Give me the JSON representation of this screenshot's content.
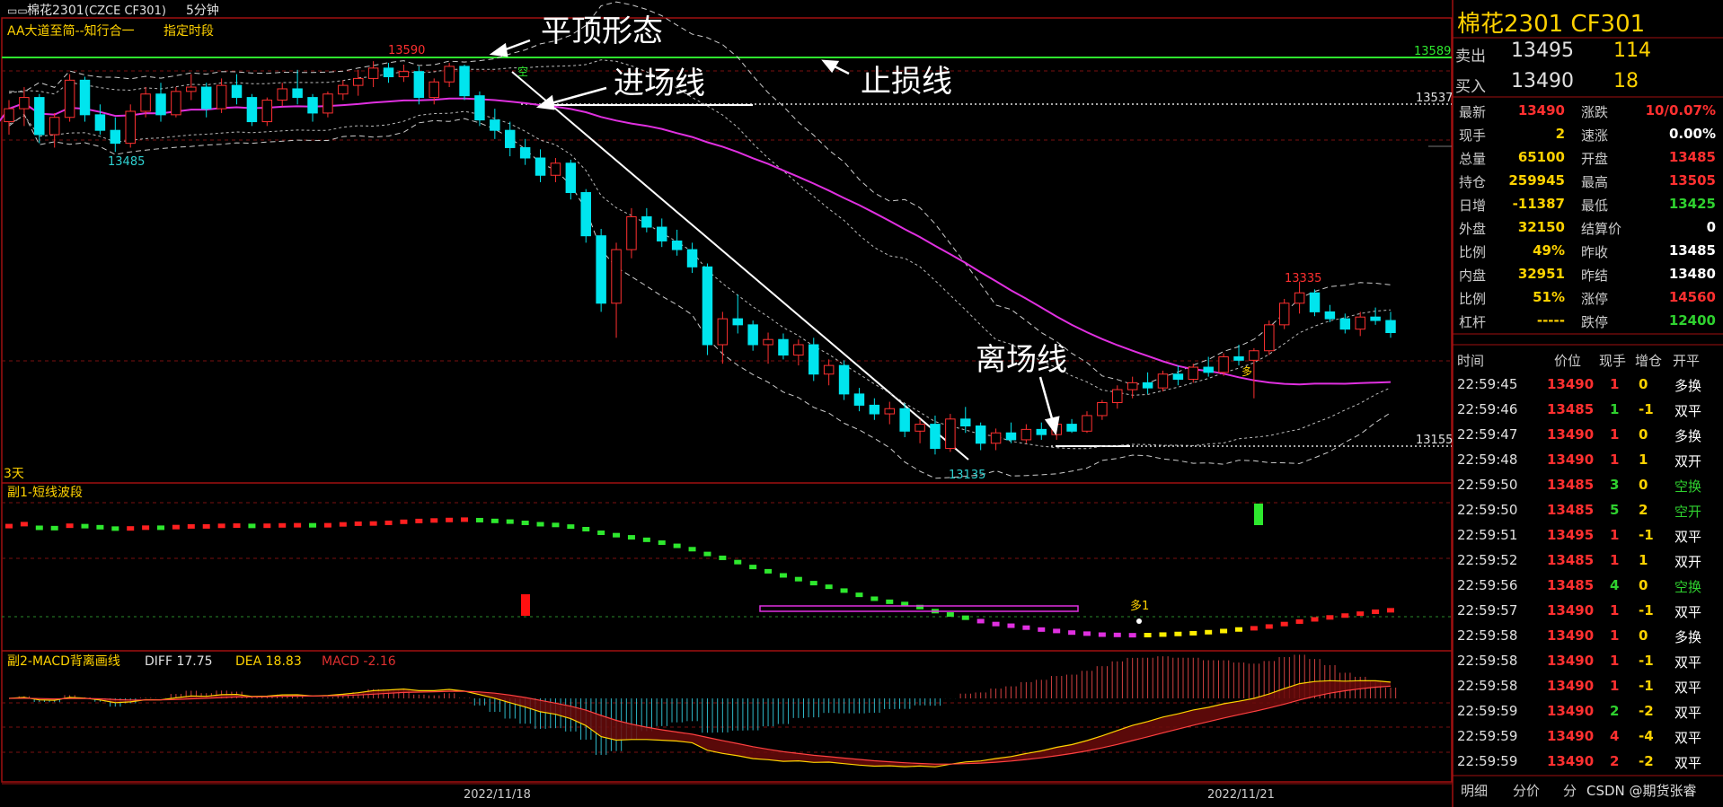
{
  "title": {
    "symbol": "棉花2301",
    "code": "(CZCE CF301)",
    "period": "5分钟"
  },
  "main_panel": {
    "indicator": "AA大道至简--知行合一",
    "segment": "指定时段",
    "span_label": "3天",
    "price_labels": {
      "high": "13590",
      "low": "13135",
      "left_low": "13485",
      "right_high": "13335"
    },
    "right_axis": {
      "stop": "13589",
      "entry": "13537",
      "exit": "13155"
    },
    "annotations": {
      "flat_top": "平顶形态",
      "entry": "进场线",
      "stop": "止损线",
      "exit": "离场线"
    },
    "markers": {
      "kong": "空",
      "duo": "多"
    }
  },
  "sub1": {
    "title": "副1-短线波段",
    "marker": "多1"
  },
  "sub2": {
    "title": "副2-MACD背离画线",
    "diff": "DIFF 17.75",
    "dea": "DEA 18.83",
    "macd": "MACD -2.16"
  },
  "x_axis": {
    "date1": "2022/11/18",
    "date2": "2022/11/21"
  },
  "quote": {
    "header": "棉花2301  CF301",
    "sell": {
      "label": "卖出",
      "price": "13495",
      "vol": "114"
    },
    "buy": {
      "label": "买入",
      "price": "13490",
      "vol": "18"
    },
    "stats": [
      [
        {
          "k": "最新",
          "v": "13490",
          "c": "#ff3030"
        },
        {
          "k": "涨跌",
          "v": "10/0.07%",
          "c": "#ff3030"
        }
      ],
      [
        {
          "k": "现手",
          "v": "2",
          "c": "#ffd200"
        },
        {
          "k": "速涨",
          "v": "0.00%",
          "c": "#ffffff"
        }
      ],
      [
        {
          "k": "总量",
          "v": "65100",
          "c": "#ffd200"
        },
        {
          "k": "开盘",
          "v": "13485",
          "c": "#ff3030"
        }
      ],
      [
        {
          "k": "持仓",
          "v": "259945",
          "c": "#ffd200"
        },
        {
          "k": "最高",
          "v": "13505",
          "c": "#ff3030"
        }
      ],
      [
        {
          "k": "日增",
          "v": "-11387",
          "c": "#ffd200"
        },
        {
          "k": "最低",
          "v": "13425",
          "c": "#2fd12f"
        }
      ],
      [
        {
          "k": "外盘",
          "v": "32150",
          "c": "#ffd200"
        },
        {
          "k": "结算价",
          "v": "0",
          "c": "#ffffff"
        }
      ],
      [
        {
          "k": "比例",
          "v": "49%",
          "c": "#ffd200"
        },
        {
          "k": "昨收",
          "v": "13485",
          "c": "#ffffff"
        }
      ],
      [
        {
          "k": "内盘",
          "v": "32951",
          "c": "#ffd200"
        },
        {
          "k": "昨结",
          "v": "13480",
          "c": "#ffffff"
        }
      ],
      [
        {
          "k": "比例",
          "v": "51%",
          "c": "#ffd200"
        },
        {
          "k": "涨停",
          "v": "14560",
          "c": "#ff3030"
        }
      ],
      [
        {
          "k": "杠杆",
          "v": "-----",
          "c": "#ffd200"
        },
        {
          "k": "跌停",
          "v": "12400",
          "c": "#2fd12f"
        }
      ]
    ],
    "trades_header": [
      "时间",
      "价位",
      "现手",
      "增仓",
      "开平"
    ],
    "trades": [
      [
        "22:59:45",
        "13490",
        "1",
        "0",
        "多换"
      ],
      [
        "22:59:46",
        "13485",
        "1",
        "-1",
        "双平"
      ],
      [
        "22:59:47",
        "13490",
        "1",
        "0",
        "多换"
      ],
      [
        "22:59:48",
        "13490",
        "1",
        "1",
        "双开"
      ],
      [
        "22:59:50",
        "13485",
        "3",
        "0",
        "空换"
      ],
      [
        "22:59:50",
        "13485",
        "5",
        "2",
        "空开"
      ],
      [
        "22:59:51",
        "13495",
        "1",
        "-1",
        "双平"
      ],
      [
        "22:59:52",
        "13485",
        "1",
        "1",
        "双开"
      ],
      [
        "22:59:56",
        "13485",
        "4",
        "0",
        "空换"
      ],
      [
        "22:59:57",
        "13490",
        "1",
        "-1",
        "双平"
      ],
      [
        "22:59:58",
        "13490",
        "1",
        "0",
        "多换"
      ],
      [
        "22:59:58",
        "13490",
        "1",
        "-1",
        "双平"
      ],
      [
        "22:59:58",
        "13490",
        "1",
        "-1",
        "双平"
      ],
      [
        "22:59:59",
        "13490",
        "2",
        "-2",
        "双平"
      ],
      [
        "22:59:59",
        "13490",
        "4",
        "-4",
        "双平"
      ],
      [
        "22:59:59",
        "13490",
        "2",
        "-2",
        "双平"
      ]
    ],
    "tabs": [
      "明细",
      "分价",
      "分"
    ],
    "watermark": "CSDN @期货张睿"
  },
  "chart_data": {
    "type": "candlestick",
    "ylim": [
      13100,
      13640
    ],
    "candles": [
      [
        13520,
        13545,
        13505,
        13535
      ],
      [
        13535,
        13560,
        13515,
        13548
      ],
      [
        13548,
        13552,
        13495,
        13505
      ],
      [
        13505,
        13530,
        13490,
        13525
      ],
      [
        13525,
        13575,
        13520,
        13568
      ],
      [
        13568,
        13572,
        13520,
        13528
      ],
      [
        13528,
        13540,
        13505,
        13510
      ],
      [
        13510,
        13525,
        13485,
        13495
      ],
      [
        13495,
        13540,
        13490,
        13532
      ],
      [
        13532,
        13560,
        13525,
        13552
      ],
      [
        13552,
        13565,
        13520,
        13528
      ],
      [
        13528,
        13560,
        13525,
        13555
      ],
      [
        13555,
        13575,
        13545,
        13560
      ],
      [
        13560,
        13565,
        13525,
        13535
      ],
      [
        13535,
        13570,
        13530,
        13562
      ],
      [
        13562,
        13575,
        13540,
        13548
      ],
      [
        13548,
        13552,
        13515,
        13520
      ],
      [
        13520,
        13548,
        13515,
        13545
      ],
      [
        13545,
        13565,
        13538,
        13558
      ],
      [
        13558,
        13580,
        13540,
        13548
      ],
      [
        13548,
        13552,
        13520,
        13530
      ],
      [
        13530,
        13555,
        13525,
        13552
      ],
      [
        13552,
        13568,
        13545,
        13562
      ],
      [
        13562,
        13580,
        13550,
        13570
      ],
      [
        13570,
        13590,
        13560,
        13582
      ],
      [
        13582,
        13588,
        13565,
        13572
      ],
      [
        13572,
        13586,
        13566,
        13578
      ],
      [
        13578,
        13584,
        13540,
        13548
      ],
      [
        13548,
        13570,
        13540,
        13566
      ],
      [
        13566,
        13588,
        13560,
        13584
      ],
      [
        13584,
        13586,
        13545,
        13550
      ],
      [
        13550,
        13555,
        13515,
        13522
      ],
      [
        13522,
        13535,
        13500,
        13510
      ],
      [
        13510,
        13520,
        13480,
        13490
      ],
      [
        13490,
        13500,
        13470,
        13478
      ],
      [
        13478,
        13488,
        13450,
        13458
      ],
      [
        13458,
        13478,
        13450,
        13472
      ],
      [
        13472,
        13476,
        13430,
        13438
      ],
      [
        13438,
        13442,
        13380,
        13388
      ],
      [
        13388,
        13396,
        13300,
        13310
      ],
      [
        13310,
        13380,
        13270,
        13372
      ],
      [
        13372,
        13420,
        13362,
        13410
      ],
      [
        13410,
        13420,
        13392,
        13398
      ],
      [
        13398,
        13408,
        13375,
        13382
      ],
      [
        13382,
        13395,
        13365,
        13372
      ],
      [
        13372,
        13380,
        13345,
        13352
      ],
      [
        13352,
        13356,
        13250,
        13262
      ],
      [
        13262,
        13300,
        13240,
        13292
      ],
      [
        13292,
        13320,
        13275,
        13285
      ],
      [
        13285,
        13290,
        13255,
        13262
      ],
      [
        13262,
        13276,
        13240,
        13268
      ],
      [
        13268,
        13275,
        13245,
        13250
      ],
      [
        13250,
        13268,
        13238,
        13262
      ],
      [
        13262,
        13270,
        13220,
        13228
      ],
      [
        13228,
        13245,
        13215,
        13238
      ],
      [
        13238,
        13244,
        13198,
        13205
      ],
      [
        13205,
        13212,
        13185,
        13192
      ],
      [
        13192,
        13200,
        13175,
        13182
      ],
      [
        13182,
        13196,
        13170,
        13188
      ],
      [
        13188,
        13194,
        13155,
        13162
      ],
      [
        13162,
        13176,
        13148,
        13170
      ],
      [
        13170,
        13180,
        13135,
        13142
      ],
      [
        13142,
        13182,
        13138,
        13176
      ],
      [
        13176,
        13190,
        13160,
        13168
      ],
      [
        13168,
        13172,
        13140,
        13148
      ],
      [
        13148,
        13165,
        13140,
        13160
      ],
      [
        13160,
        13172,
        13148,
        13152
      ],
      [
        13152,
        13170,
        13148,
        13164
      ],
      [
        13164,
        13172,
        13152,
        13158
      ],
      [
        13158,
        13175,
        13152,
        13170
      ],
      [
        13170,
        13176,
        13160,
        13162
      ],
      [
        13162,
        13185,
        13160,
        13180
      ],
      [
        13180,
        13198,
        13175,
        13195
      ],
      [
        13195,
        13215,
        13188,
        13210
      ],
      [
        13210,
        13225,
        13200,
        13218
      ],
      [
        13218,
        13230,
        13205,
        13212
      ],
      [
        13212,
        13232,
        13208,
        13228
      ],
      [
        13228,
        13238,
        13215,
        13222
      ],
      [
        13222,
        13240,
        13218,
        13236
      ],
      [
        13236,
        13248,
        13225,
        13230
      ],
      [
        13230,
        13252,
        13226,
        13248
      ],
      [
        13248,
        13262,
        13238,
        13244
      ],
      [
        13244,
        13258,
        13200,
        13255
      ],
      [
        13255,
        13290,
        13250,
        13285
      ],
      [
        13285,
        13315,
        13280,
        13310
      ],
      [
        13310,
        13335,
        13298,
        13322
      ],
      [
        13322,
        13326,
        13295,
        13300
      ],
      [
        13300,
        13308,
        13288,
        13292
      ],
      [
        13292,
        13298,
        13275,
        13280
      ],
      [
        13280,
        13300,
        13272,
        13294
      ],
      [
        13294,
        13305,
        13285,
        13290
      ],
      [
        13290,
        13300,
        13270,
        13276
      ]
    ]
  }
}
